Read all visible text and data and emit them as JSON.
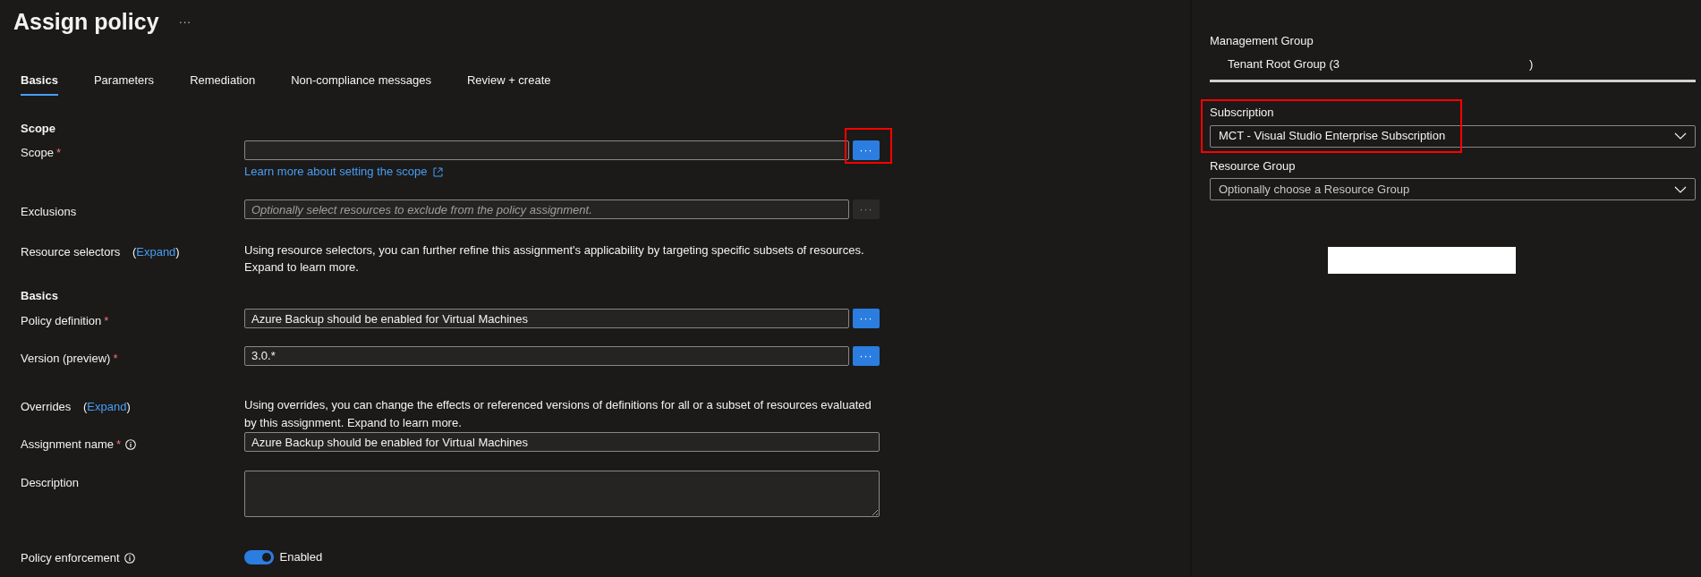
{
  "page": {
    "title": "Assign policy",
    "more": "···"
  },
  "tabs": [
    {
      "label": "Basics",
      "selected": true
    },
    {
      "label": "Parameters",
      "selected": false
    },
    {
      "label": "Remediation",
      "selected": false
    },
    {
      "label": "Non-compliance messages",
      "selected": false
    },
    {
      "label": "Review + create",
      "selected": false
    }
  ],
  "form": [
    {
      "kind": "section",
      "label": "Scope"
    },
    {
      "kind": "field",
      "label": "Scope",
      "required_mark": "*",
      "info": false,
      "browse": {
        "label": "···",
        "disabled": false,
        "highlighted": true
      },
      "link": "Learn more about setting the scope"
    },
    {
      "kind": "field",
      "label": "Exclusions",
      "info": false,
      "placeholder": "Optionally select resources to exclude from the policy assignment.",
      "browse": {
        "label": "···",
        "disabled": true,
        "highlighted": false
      }
    },
    {
      "kind": "note",
      "label": "Resource selectors",
      "expand": {
        "open": "(",
        "label": "Expand",
        "close": ")"
      },
      "text": "Using resource selectors, you can further refine this assignment's applicability by targeting specific subsets of resources. Expand to learn more."
    },
    {
      "kind": "section",
      "label": "Basics"
    },
    {
      "kind": "field",
      "label": "Policy definition",
      "required_mark": "*",
      "info": false,
      "value": "Azure Backup should be enabled for Virtual Machines",
      "browse": {
        "label": "···",
        "disabled": false,
        "highlighted": false
      }
    },
    {
      "kind": "field",
      "label": "Version (preview)",
      "required_mark": "*",
      "info": false,
      "value": "3.0.*",
      "browse": {
        "label": "···",
        "disabled": false,
        "highlighted": false
      }
    },
    {
      "kind": "note",
      "label": "Overrides",
      "expand": {
        "open": "(",
        "label": "Expand",
        "close": ")"
      },
      "text": "Using overrides, you can change the effects or referenced versions of definitions for all or a subset of resources evaluated by this assignment. Expand to learn more."
    },
    {
      "kind": "field",
      "label": "Assignment name",
      "required_mark": "*",
      "info": true,
      "value": "Azure Backup should be enabled for Virtual Machines"
    },
    {
      "kind": "textarea",
      "label": "Description"
    },
    {
      "kind": "toggle",
      "label": "Policy enforcement",
      "info": true,
      "on": true,
      "state": "Enabled"
    }
  ],
  "scope_panel": {
    "management_group": {
      "label": "Management Group",
      "value_start": "Tenant Root Group (3",
      "value_end": ")"
    },
    "subscription": {
      "label": "Subscription",
      "value": "MCT - Visual Studio Enterprise Subscription",
      "highlighted": true
    },
    "resource_group": {
      "label": "Resource Group",
      "placeholder": "Optionally choose a Resource Group"
    }
  }
}
